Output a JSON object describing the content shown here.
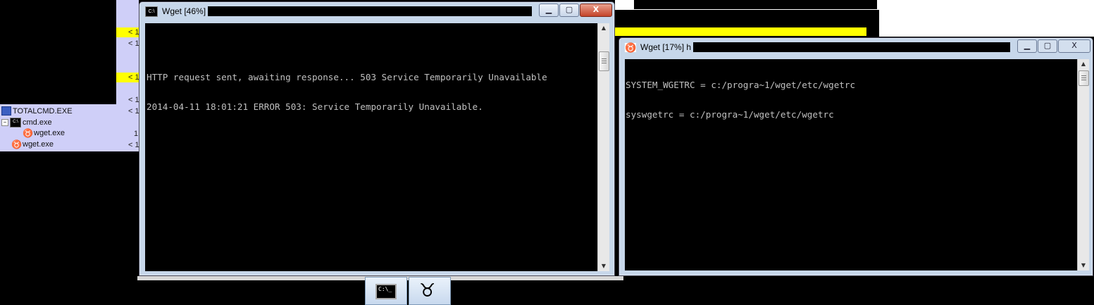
{
  "background": {
    "total_commander_rows": [
      {
        "name": "TOTALCMD.EXE",
        "icon": "floppy-icon"
      },
      {
        "name": "cmd.exe",
        "icon": "cmd-icon"
      },
      {
        "name": "wget.exe",
        "icon": "gnu-icon"
      },
      {
        "name": "wget.exe",
        "icon": "gnu-icon"
      }
    ],
    "lt_values": [
      "< 1",
      "< 1",
      "< 1",
      "< 1",
      "< 1",
      "1",
      "< 1"
    ],
    "highlight_color": "#ffff00",
    "panel_color": "#cfcff8"
  },
  "window1": {
    "title": "Wget [46%]",
    "lines": [
      "HTTP request sent, awaiting response... 503 Service Temporarily Unavailable",
      "2014-04-11 18:01:21 ERROR 503: Service Temporarily Unavailable."
    ],
    "icon": "console-icon",
    "minimize_glyph": "▁",
    "maximize_glyph": "▢",
    "close_glyph": "X"
  },
  "window2": {
    "title": "Wget [17%] h",
    "lines": [
      "SYSTEM_WGETRC = c:/progra~1/wget/etc/wgetrc",
      "syswgetrc = c:/progra~1/wget/etc/wgetrc"
    ],
    "icon": "gnu-icon",
    "minimize_glyph": "▁",
    "maximize_glyph": "▢",
    "close_glyph": "X"
  },
  "scroll": {
    "up": "▲",
    "down": "▼"
  },
  "taskbar": {
    "cmd_icon_text": "C:\\_",
    "gnu_icon_glyph": "♉"
  }
}
